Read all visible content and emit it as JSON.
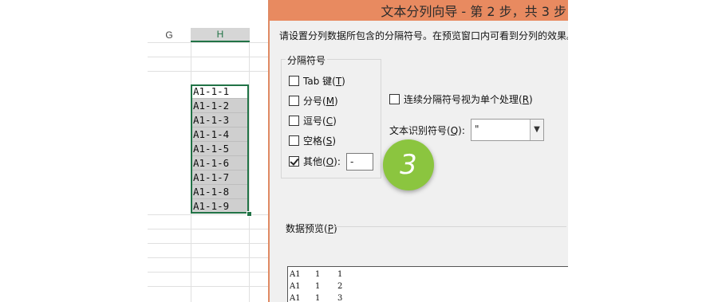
{
  "sheet": {
    "columns": [
      "G",
      "H"
    ],
    "cells": [
      "A1-1-1",
      "A1-1-2",
      "A1-1-3",
      "A1-1-4",
      "A1-1-5",
      "A1-1-6",
      "A1-1-7",
      "A1-1-8",
      "A1-1-9"
    ]
  },
  "dialog": {
    "title": "文本分列向导 - 第 2 步，共 3 步",
    "instruction": "请设置分列数据所包含的分隔符号。在预览窗口内可看到分列的效果。",
    "delimiters": {
      "legend": "分隔符号",
      "tab": {
        "label": "Tab 键(",
        "key": "T",
        "tail": ")",
        "checked": false
      },
      "semicolon": {
        "label": "分号(",
        "key": "M",
        "tail": ")",
        "checked": false
      },
      "comma": {
        "label": "逗号(",
        "key": "C",
        "tail": ")",
        "checked": false
      },
      "space": {
        "label": "空格(",
        "key": "S",
        "tail": ")",
        "checked": false
      },
      "other": {
        "label": "其他(",
        "key": "O",
        "tail": "):",
        "checked": true,
        "value": "-"
      }
    },
    "consecutive": {
      "label": "连续分隔符号视为单个处理(",
      "key": "R",
      "tail": ")",
      "checked": false
    },
    "text_qualifier": {
      "label": "文本识别符号(",
      "key": "Q",
      "tail": "):",
      "value": "\""
    },
    "preview": {
      "label": "数据预览(",
      "key": "P",
      "tail": ")",
      "rows": [
        [
          "A1",
          "1",
          "1"
        ],
        [
          "A1",
          "1",
          "2"
        ],
        [
          "A1",
          "1",
          "3"
        ]
      ]
    }
  },
  "annotation": {
    "step_number": "3",
    "badge_color": "#8bc53f"
  },
  "colors": {
    "title_bar": "#e88a60",
    "selection": "#217346"
  }
}
